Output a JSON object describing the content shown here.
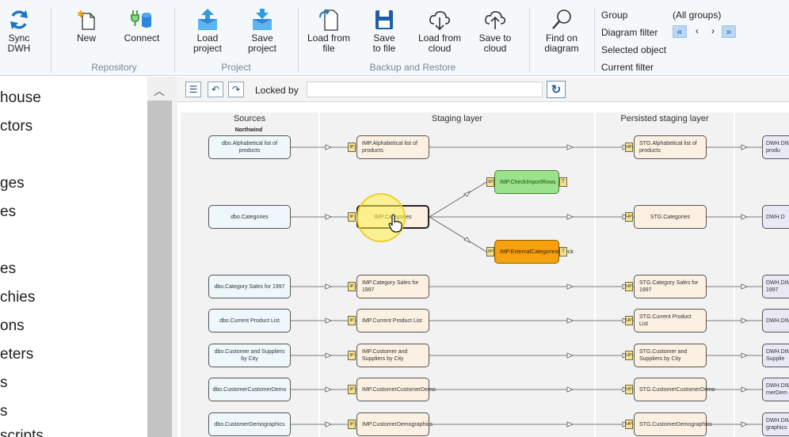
{
  "ribbon": {
    "buttons": {
      "sync_dwh": "Sync\nDWH",
      "new": "New",
      "connect": "Connect",
      "load_project": "Load\nproject",
      "save_project": "Save\nproject",
      "load_from_file": "Load from\nfile",
      "save_to_file": "Save\nto file",
      "load_from_cloud": "Load from\ncloud",
      "save_to_cloud": "Save to\ncloud",
      "find_on_diagram": "Find on\ndiagram"
    },
    "groups": {
      "repository": "Repository",
      "project": "Project",
      "backup_restore": "Backup and Restore"
    },
    "filters": {
      "group_label": "Group",
      "group_value": "(All groups)",
      "diagram_filter_label": "Diagram filter",
      "selected_object_label": "Selected object",
      "current_filter_label": "Current filter",
      "nav_first": "«",
      "nav_prev": "‹",
      "nav_next": "›",
      "nav_last": "»"
    }
  },
  "tree": {
    "items": [
      "house",
      "ctors",
      "ges",
      "es",
      "es",
      "chies",
      "ons",
      "eters",
      "s",
      "s",
      "scripts"
    ]
  },
  "toolbar": {
    "locked_by_label": "Locked by",
    "locked_by_value": ""
  },
  "diagram": {
    "lanes": {
      "sources": "Sources",
      "staging": "Staging layer",
      "persisted": "Persisted staging layer"
    },
    "source_group": "Northwind",
    "rows": [
      {
        "src": "dbo.Alphabetical list of products",
        "imp": "IMP.Alphabetical list of products",
        "stg": "STG.Alphabetical list of products",
        "dwh": "DWH.DIM of produ"
      },
      {
        "src": "dbo.Categories",
        "imp": "IMP.Categories",
        "stg": "STG.Categories",
        "dwh": "DWH.D"
      },
      {
        "src": "dbo.Category Sales for 1997",
        "imp": "IMP.Category Sales for 1997",
        "stg": "STG.Category Sales for 1997",
        "dwh": "DWH.DIM for 1997"
      },
      {
        "src": "dbo.Current Product List",
        "imp": "IMP.Current Product List",
        "stg": "STG.Current Product List",
        "dwh": "DWH.DIM List"
      },
      {
        "src": "dbo.Customer and Suppliers by City",
        "imp": "IMP.Customer and Suppliers by City",
        "stg": "STG.Customer and Suppliers by City",
        "dwh": "DWH.DIM Supplie"
      },
      {
        "src": "dbo.CustomerCustomerDemo",
        "imp": "IMP.CustomerCustomerDemo",
        "stg": "STG.CustomerCustomerDemo",
        "dwh": "DWH.DIM merDem"
      },
      {
        "src": "dbo.CustomerDemographics",
        "imp": "IMP.CustomerDemographics",
        "stg": "STG.CustomerDemographics",
        "dwh": "DWH.DIM graphics"
      }
    ],
    "check_node": "IMP.CheckImportRows",
    "external_check_node": "IMP.ExternalCategoriesCheck",
    "tags": {
      "ip": "IP",
      "hp": "HP",
      "sp": "SP",
      "xp": "XP",
      "t": "T"
    }
  }
}
